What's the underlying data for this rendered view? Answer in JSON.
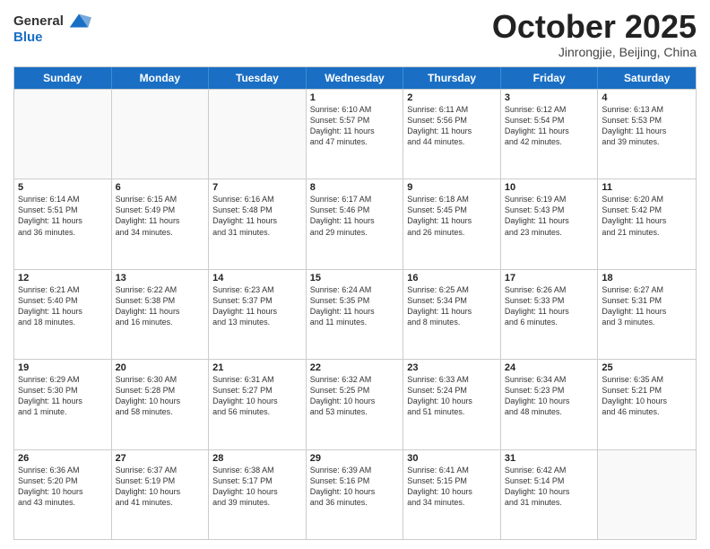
{
  "header": {
    "logo_general": "General",
    "logo_blue": "Blue",
    "month_title": "October 2025",
    "location": "Jinrongjie, Beijing, China"
  },
  "weekdays": [
    "Sunday",
    "Monday",
    "Tuesday",
    "Wednesday",
    "Thursday",
    "Friday",
    "Saturday"
  ],
  "weeks": [
    [
      {
        "day": "",
        "empty": true
      },
      {
        "day": "",
        "empty": true
      },
      {
        "day": "",
        "empty": true
      },
      {
        "day": "1",
        "lines": [
          "Sunrise: 6:10 AM",
          "Sunset: 5:57 PM",
          "Daylight: 11 hours",
          "and 47 minutes."
        ]
      },
      {
        "day": "2",
        "lines": [
          "Sunrise: 6:11 AM",
          "Sunset: 5:56 PM",
          "Daylight: 11 hours",
          "and 44 minutes."
        ]
      },
      {
        "day": "3",
        "lines": [
          "Sunrise: 6:12 AM",
          "Sunset: 5:54 PM",
          "Daylight: 11 hours",
          "and 42 minutes."
        ]
      },
      {
        "day": "4",
        "lines": [
          "Sunrise: 6:13 AM",
          "Sunset: 5:53 PM",
          "Daylight: 11 hours",
          "and 39 minutes."
        ]
      }
    ],
    [
      {
        "day": "5",
        "lines": [
          "Sunrise: 6:14 AM",
          "Sunset: 5:51 PM",
          "Daylight: 11 hours",
          "and 36 minutes."
        ]
      },
      {
        "day": "6",
        "lines": [
          "Sunrise: 6:15 AM",
          "Sunset: 5:49 PM",
          "Daylight: 11 hours",
          "and 34 minutes."
        ]
      },
      {
        "day": "7",
        "lines": [
          "Sunrise: 6:16 AM",
          "Sunset: 5:48 PM",
          "Daylight: 11 hours",
          "and 31 minutes."
        ]
      },
      {
        "day": "8",
        "lines": [
          "Sunrise: 6:17 AM",
          "Sunset: 5:46 PM",
          "Daylight: 11 hours",
          "and 29 minutes."
        ]
      },
      {
        "day": "9",
        "lines": [
          "Sunrise: 6:18 AM",
          "Sunset: 5:45 PM",
          "Daylight: 11 hours",
          "and 26 minutes."
        ]
      },
      {
        "day": "10",
        "lines": [
          "Sunrise: 6:19 AM",
          "Sunset: 5:43 PM",
          "Daylight: 11 hours",
          "and 23 minutes."
        ]
      },
      {
        "day": "11",
        "lines": [
          "Sunrise: 6:20 AM",
          "Sunset: 5:42 PM",
          "Daylight: 11 hours",
          "and 21 minutes."
        ]
      }
    ],
    [
      {
        "day": "12",
        "lines": [
          "Sunrise: 6:21 AM",
          "Sunset: 5:40 PM",
          "Daylight: 11 hours",
          "and 18 minutes."
        ]
      },
      {
        "day": "13",
        "lines": [
          "Sunrise: 6:22 AM",
          "Sunset: 5:38 PM",
          "Daylight: 11 hours",
          "and 16 minutes."
        ]
      },
      {
        "day": "14",
        "lines": [
          "Sunrise: 6:23 AM",
          "Sunset: 5:37 PM",
          "Daylight: 11 hours",
          "and 13 minutes."
        ]
      },
      {
        "day": "15",
        "lines": [
          "Sunrise: 6:24 AM",
          "Sunset: 5:35 PM",
          "Daylight: 11 hours",
          "and 11 minutes."
        ]
      },
      {
        "day": "16",
        "lines": [
          "Sunrise: 6:25 AM",
          "Sunset: 5:34 PM",
          "Daylight: 11 hours",
          "and 8 minutes."
        ]
      },
      {
        "day": "17",
        "lines": [
          "Sunrise: 6:26 AM",
          "Sunset: 5:33 PM",
          "Daylight: 11 hours",
          "and 6 minutes."
        ]
      },
      {
        "day": "18",
        "lines": [
          "Sunrise: 6:27 AM",
          "Sunset: 5:31 PM",
          "Daylight: 11 hours",
          "and 3 minutes."
        ]
      }
    ],
    [
      {
        "day": "19",
        "lines": [
          "Sunrise: 6:29 AM",
          "Sunset: 5:30 PM",
          "Daylight: 11 hours",
          "and 1 minute."
        ]
      },
      {
        "day": "20",
        "lines": [
          "Sunrise: 6:30 AM",
          "Sunset: 5:28 PM",
          "Daylight: 10 hours",
          "and 58 minutes."
        ]
      },
      {
        "day": "21",
        "lines": [
          "Sunrise: 6:31 AM",
          "Sunset: 5:27 PM",
          "Daylight: 10 hours",
          "and 56 minutes."
        ]
      },
      {
        "day": "22",
        "lines": [
          "Sunrise: 6:32 AM",
          "Sunset: 5:25 PM",
          "Daylight: 10 hours",
          "and 53 minutes."
        ]
      },
      {
        "day": "23",
        "lines": [
          "Sunrise: 6:33 AM",
          "Sunset: 5:24 PM",
          "Daylight: 10 hours",
          "and 51 minutes."
        ]
      },
      {
        "day": "24",
        "lines": [
          "Sunrise: 6:34 AM",
          "Sunset: 5:23 PM",
          "Daylight: 10 hours",
          "and 48 minutes."
        ]
      },
      {
        "day": "25",
        "lines": [
          "Sunrise: 6:35 AM",
          "Sunset: 5:21 PM",
          "Daylight: 10 hours",
          "and 46 minutes."
        ]
      }
    ],
    [
      {
        "day": "26",
        "lines": [
          "Sunrise: 6:36 AM",
          "Sunset: 5:20 PM",
          "Daylight: 10 hours",
          "and 43 minutes."
        ]
      },
      {
        "day": "27",
        "lines": [
          "Sunrise: 6:37 AM",
          "Sunset: 5:19 PM",
          "Daylight: 10 hours",
          "and 41 minutes."
        ]
      },
      {
        "day": "28",
        "lines": [
          "Sunrise: 6:38 AM",
          "Sunset: 5:17 PM",
          "Daylight: 10 hours",
          "and 39 minutes."
        ]
      },
      {
        "day": "29",
        "lines": [
          "Sunrise: 6:39 AM",
          "Sunset: 5:16 PM",
          "Daylight: 10 hours",
          "and 36 minutes."
        ]
      },
      {
        "day": "30",
        "lines": [
          "Sunrise: 6:41 AM",
          "Sunset: 5:15 PM",
          "Daylight: 10 hours",
          "and 34 minutes."
        ]
      },
      {
        "day": "31",
        "lines": [
          "Sunrise: 6:42 AM",
          "Sunset: 5:14 PM",
          "Daylight: 10 hours",
          "and 31 minutes."
        ]
      },
      {
        "day": "",
        "empty": true
      }
    ]
  ]
}
